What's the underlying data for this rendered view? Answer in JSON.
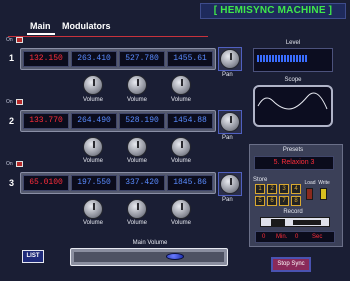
{
  "app": {
    "title": "[ HEMISYNC MACHINE ]"
  },
  "tabs": [
    {
      "label": "Main"
    },
    {
      "label": "Modulators"
    }
  ],
  "channels": [
    {
      "number": "1",
      "on_label": "On",
      "values": [
        "132.150",
        "263.410",
        "527.780",
        "1455.61"
      ],
      "pan_label": "Pan"
    },
    {
      "number": "2",
      "on_label": "On",
      "values": [
        "133.770",
        "264.490",
        "528.190",
        "1454.88"
      ],
      "pan_label": "Pan"
    },
    {
      "number": "3",
      "on_label": "On",
      "values": [
        "65.0100",
        "197.550",
        "337.420",
        "1845.86"
      ],
      "pan_label": "Pan"
    }
  ],
  "volume_label": "Volume",
  "level": {
    "label": "Level"
  },
  "scope": {
    "label": "Scope"
  },
  "presets": {
    "label": "Presets",
    "current": "5. Relaxion 3",
    "store_label": "Store",
    "buttons": [
      "1",
      "2",
      "3",
      "4",
      "5",
      "6",
      "7",
      "8"
    ],
    "load_label": "Load",
    "write_label": "Write"
  },
  "record": {
    "label": "Record",
    "hours": "0",
    "min_label": "Min.",
    "minutes": "0",
    "sec_label": "Sec"
  },
  "list_button": "LIST",
  "main_volume": {
    "label": "Main Volume",
    "level": 0.7
  },
  "stop_sync_button": "Stop Sync",
  "colors": {
    "title": "#3fe84a",
    "display_red": "#ff2d3a",
    "display_blue": "#5a8cff"
  }
}
